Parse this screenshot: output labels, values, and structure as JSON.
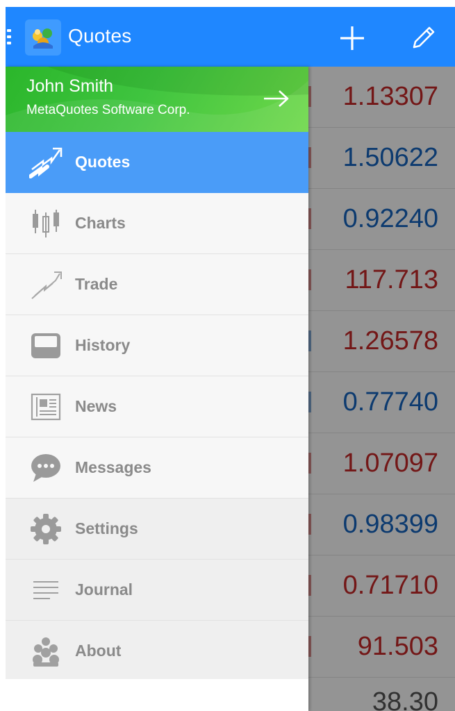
{
  "appbar": {
    "title": "Quotes",
    "add_icon": "plus-icon",
    "edit_icon": "pencil-icon",
    "color": "#1f87ff"
  },
  "account": {
    "name": "John Smith",
    "company": "MetaQuotes Software Corp.",
    "arrow_icon": "arrow-right-icon"
  },
  "nav": [
    {
      "label": "Quotes",
      "icon": "quotes-arrows-icon",
      "active": true
    },
    {
      "label": "Charts",
      "icon": "candlestick-icon"
    },
    {
      "label": "Trade",
      "icon": "trade-trend-icon"
    },
    {
      "label": "History",
      "icon": "inbox-tray-icon"
    },
    {
      "label": "News",
      "icon": "newspaper-icon"
    },
    {
      "label": "Messages",
      "icon": "chat-bubble-icon"
    },
    {
      "label": "Settings",
      "icon": "gear-icon"
    },
    {
      "label": "Journal",
      "icon": "journal-lines-icon"
    },
    {
      "label": "About",
      "icon": "about-logo-icon"
    }
  ],
  "quotes": [
    {
      "value": "1.13307",
      "color": "#c62828"
    },
    {
      "value": "1.50622",
      "color": "#1565c0"
    },
    {
      "value": "0.92240",
      "color": "#1565c0"
    },
    {
      "value": "117.713",
      "color": "#c62828"
    },
    {
      "value": "1.26578",
      "color": "#c62828"
    },
    {
      "value": "0.77740",
      "color": "#1565c0"
    },
    {
      "value": "1.07097",
      "color": "#c62828"
    },
    {
      "value": "0.98399",
      "color": "#1565c0"
    },
    {
      "value": "0.71710",
      "color": "#c62828"
    },
    {
      "value": "91.503",
      "color": "#c62828"
    },
    {
      "value": "38.30",
      "color": "#555555"
    }
  ]
}
